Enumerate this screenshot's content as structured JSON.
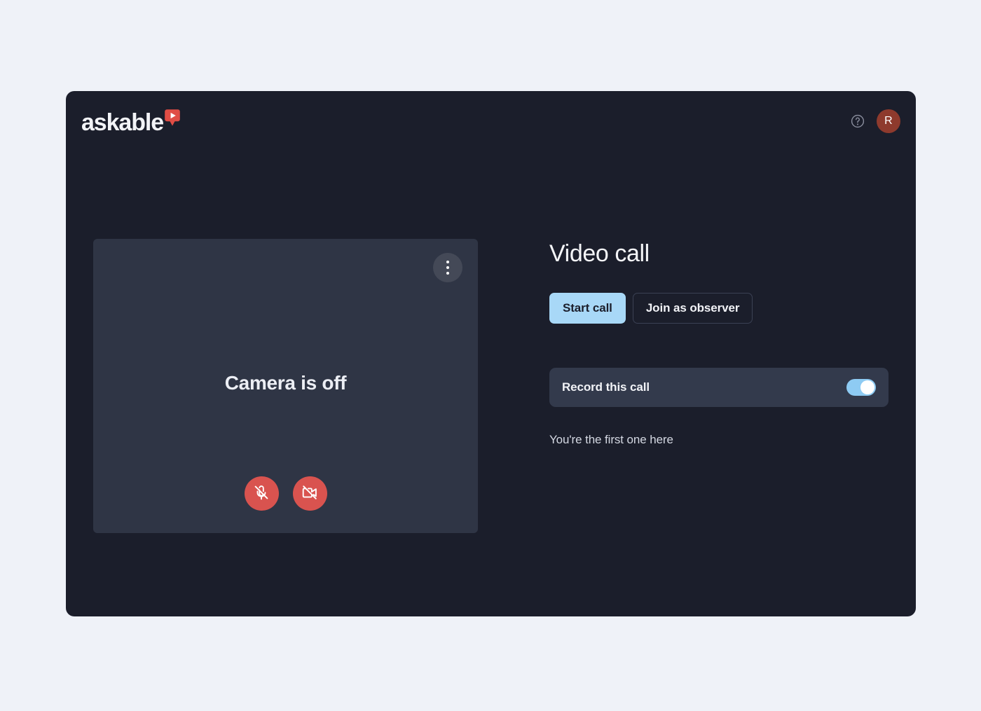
{
  "brand": {
    "name": "askable",
    "mark_icon": "askable-pin-play-icon",
    "mark_color": "#e04d45",
    "word_color": "#f2f3f7"
  },
  "topbar": {
    "help_icon": "help-circle-icon",
    "avatar_initial": "R",
    "avatar_color": "#8e3a2d"
  },
  "video_tile": {
    "menu_icon": "kebab-menu-icon",
    "status_text": "Camera is off",
    "controls": [
      {
        "icon": "microphone-off-icon",
        "state": "muted",
        "color": "#d9534f"
      },
      {
        "icon": "camera-off-icon",
        "state": "off",
        "color": "#d9534f"
      }
    ]
  },
  "panel": {
    "title": "Video call",
    "primary_button": "Start call",
    "secondary_button": "Join as observer",
    "record": {
      "label": "Record this call",
      "enabled": true
    },
    "presence_text": "You're the first one here"
  },
  "theme": {
    "page_background": "#eff2f8",
    "card_background": "#1b1e2b",
    "tile_background": "#2f3545",
    "accent_blue": "#a8d8f7",
    "row_background": "#333a4c"
  }
}
